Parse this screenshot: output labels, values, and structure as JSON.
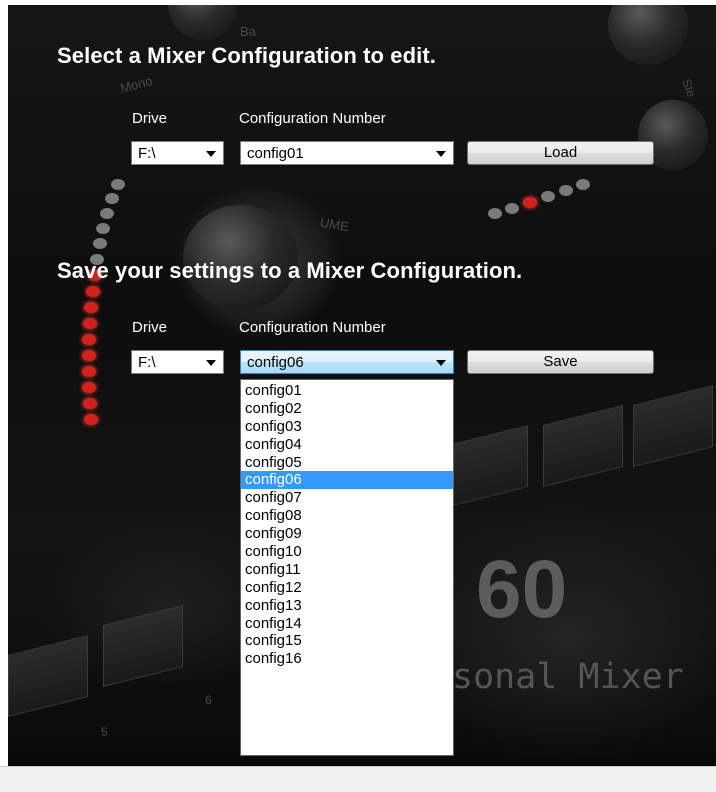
{
  "load_section": {
    "heading": "Select a Mixer Configuration to edit.",
    "drive_label": "Drive",
    "drive_value": "F:\\",
    "config_label": "Configuration Number",
    "config_value": "config01",
    "button_label": "Load"
  },
  "save_section": {
    "heading": "Save your settings to a Mixer Configuration.",
    "drive_label": "Drive",
    "drive_value": "F:\\",
    "config_label": "Configuration Number",
    "config_value": "config06",
    "button_label": "Save"
  },
  "dropdown": {
    "selected_index": 5,
    "options": [
      "config01",
      "config02",
      "config03",
      "config04",
      "config05",
      "config06",
      "config07",
      "config08",
      "config09",
      "config10",
      "config11",
      "config12",
      "config13",
      "config14",
      "config15",
      "config16"
    ]
  },
  "background_art": {
    "top_knob_labels": [
      "Mono",
      "Ba",
      "Ste"
    ],
    "volume_label": "UME",
    "logo_number": "60",
    "logo_subtitle": "sonal Mixer",
    "pad_numbers": [
      "5",
      "6"
    ]
  },
  "colors": {
    "selection": "#3399ff",
    "led_red": "#d1221e",
    "heading_text": "#ffffff"
  }
}
